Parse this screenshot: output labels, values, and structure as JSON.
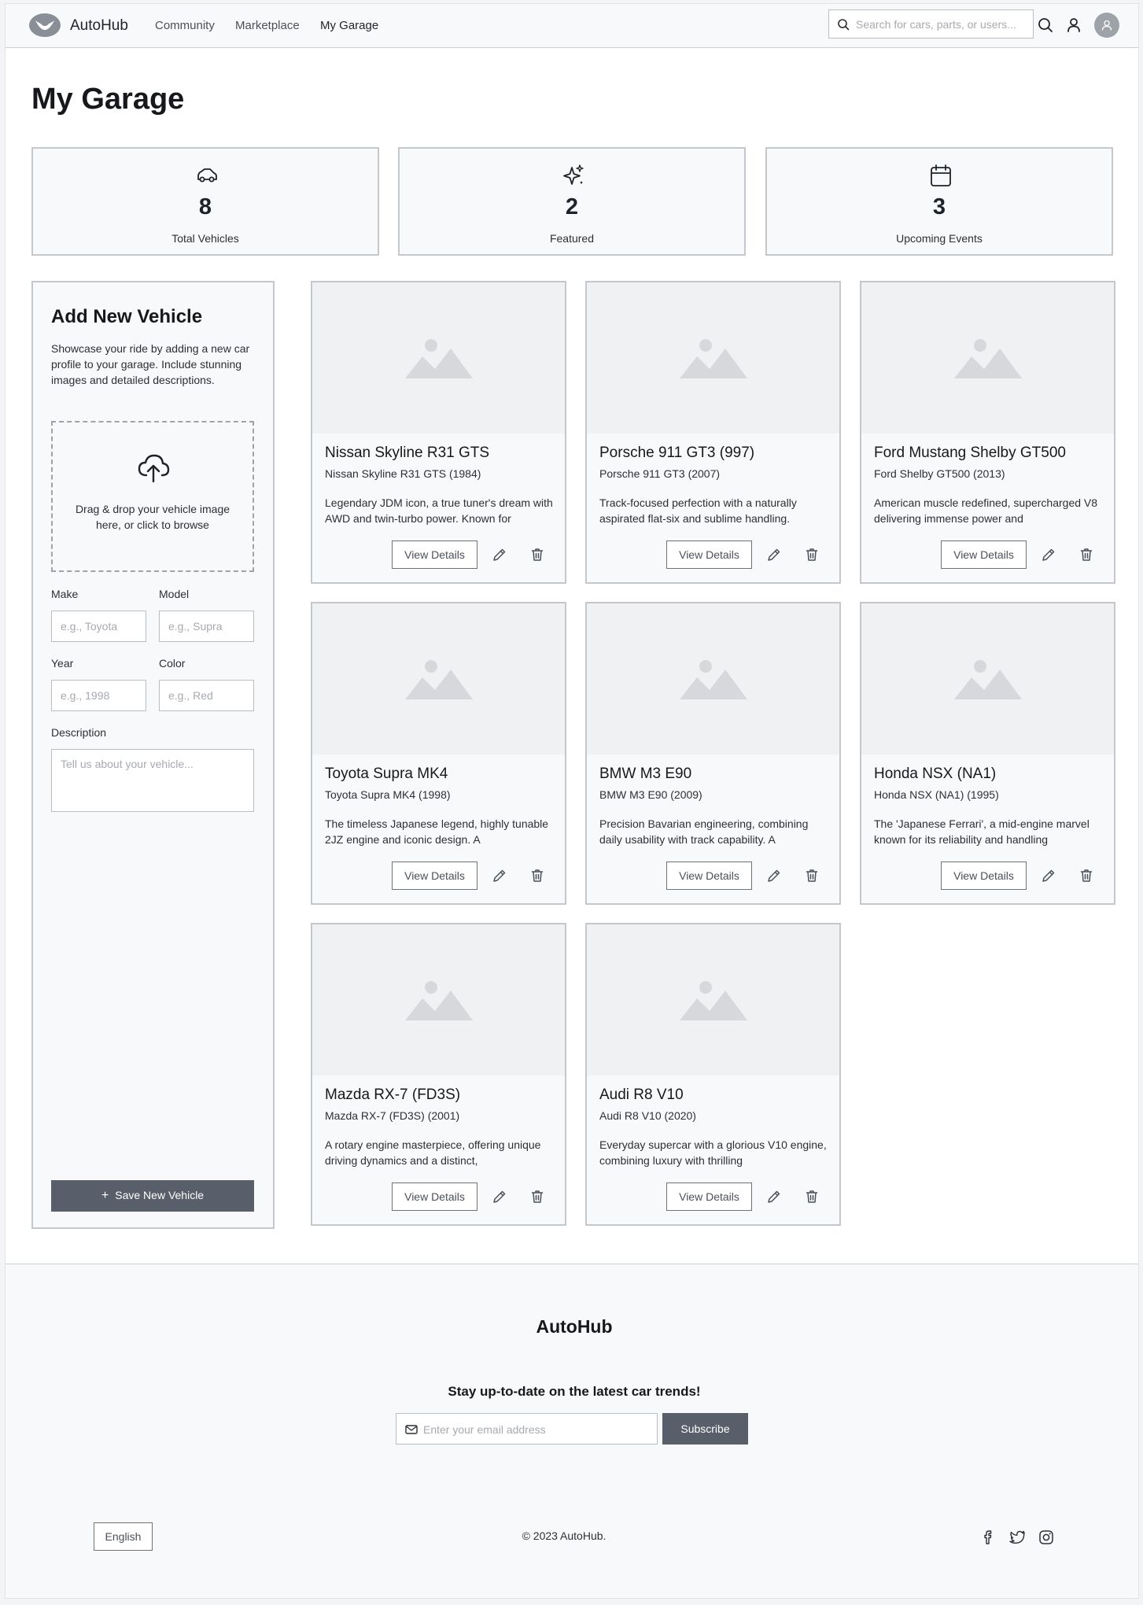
{
  "header": {
    "brand": "AutoHub",
    "nav": [
      {
        "label": "Community"
      },
      {
        "label": "Marketplace"
      },
      {
        "label": "My Garage",
        "active": true
      }
    ],
    "search_placeholder": "Search for cars, parts, or users...",
    "icons": [
      "logo-icon",
      "search-icon",
      "user-icon",
      "avatar-icon"
    ]
  },
  "page": {
    "title": "My Garage"
  },
  "stats": [
    {
      "icon": "car-icon",
      "value": "8",
      "label": "Total Vehicles"
    },
    {
      "icon": "sparkles-icon",
      "value": "2",
      "label": "Featured"
    },
    {
      "icon": "calendar-icon",
      "value": "3",
      "label": "Upcoming Events"
    }
  ],
  "add_vehicle": {
    "title": "Add New Vehicle",
    "description": "Showcase your ride by adding a new car profile to your garage. Include stunning images and detailed descriptions.",
    "dropzone_text": "Drag & drop your vehicle image here, or click to browse",
    "make_label": "Make",
    "make_placeholder": "e.g., Toyota",
    "model_label": "Model",
    "model_placeholder": "e.g., Supra",
    "year_label": "Year",
    "year_placeholder": "e.g., 1998",
    "color_label": "Color",
    "color_placeholder": "e.g., Red",
    "description_label": "Description",
    "description_placeholder": "Tell us about your vehicle...",
    "save_label": "Save New Vehicle"
  },
  "vehicles": [
    {
      "title": "Nissan Skyline R31 GTS",
      "subtitle": "Nissan Skyline R31 GTS (1984)",
      "description": "Legendary JDM icon, a true tuner's dream with AWD and twin-turbo power. Known for"
    },
    {
      "title": "Porsche 911 GT3 (997)",
      "subtitle": "Porsche 911 GT3 (2007)",
      "description": "Track-focused perfection with a naturally aspirated flat-six and sublime handling."
    },
    {
      "title": "Ford Mustang Shelby GT500",
      "subtitle": "Ford Shelby GT500 (2013)",
      "description": "American muscle redefined, supercharged V8 delivering immense power and"
    },
    {
      "title": "Toyota Supra MK4",
      "subtitle": "Toyota Supra MK4 (1998)",
      "description": "The timeless Japanese legend, highly tunable 2JZ engine and iconic design. A"
    },
    {
      "title": "BMW M3 E90",
      "subtitle": "BMW M3 E90 (2009)",
      "description": "Precision Bavarian engineering, combining daily usability with track capability. A"
    },
    {
      "title": "Honda NSX (NA1)",
      "subtitle": "Honda NSX (NA1) (1995)",
      "description": "The 'Japanese Ferrari', a mid-engine marvel known for its reliability and handling"
    },
    {
      "title": "Mazda RX-7 (FD3S)",
      "subtitle": "Mazda RX-7 (FD3S) (2001)",
      "description": "A rotary engine masterpiece, offering unique driving dynamics and a distinct,"
    },
    {
      "title": "Audi R8 V10",
      "subtitle": "Audi R8 V10 (2020)",
      "description": "Everyday supercar with a glorious V10 engine, combining luxury with thrilling"
    }
  ],
  "card_actions": {
    "view_label": "View Details",
    "icons": [
      "image-placeholder-icon",
      "pencil-icon",
      "trash-icon"
    ]
  },
  "footer": {
    "brand": "AutoHub",
    "newsletter_heading": "Stay up-to-date on the latest car trends!",
    "email_placeholder": "Enter your email address",
    "subscribe_label": "Subscribe",
    "language_label": "English",
    "copyright": "© 2023 AutoHub.",
    "social_icons": [
      "facebook-icon",
      "twitter-icon",
      "instagram-icon"
    ]
  },
  "colors": {
    "primary_button": "#595f6a",
    "border": "#c4c7cc",
    "surface": "#f8f9fa",
    "image_placeholder": "#f0f1f3"
  }
}
